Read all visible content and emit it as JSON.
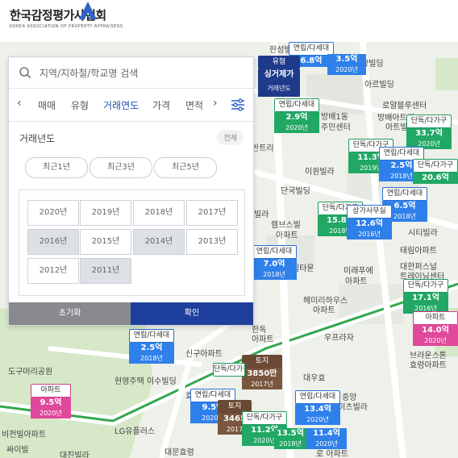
{
  "logo": {
    "ko": "한국감정평가사협회",
    "en": "KOREA ASSOCIATION OF PROPERTY APPRAISERS"
  },
  "search": {
    "placeholder": "지역/지하철/학교명 검색"
  },
  "tabs": [
    "매매",
    "유형",
    "거래연도",
    "가격",
    "면적"
  ],
  "active_tab": "거래연도",
  "section": {
    "title": "거래년도",
    "all_label": "전체"
  },
  "quick": [
    "최근1년",
    "최근3년",
    "최근5년"
  ],
  "years": [
    "2020년",
    "2019년",
    "2018년",
    "2017년",
    "2016년",
    "2015년",
    "2014년",
    "2013년",
    "2012년",
    "2011년"
  ],
  "selected_years": [
    "2016년",
    "2014년",
    "2011년"
  ],
  "buttons": {
    "reset": "초기화",
    "confirm": "확인"
  },
  "colors": {
    "accent": "#1e3f9b",
    "active_tab": "#1f4fb5"
  },
  "map_labels": [
    "한성빌",
    "광빌딩",
    "아르빌딩",
    "로얄블루센터",
    "방배1동",
    "주민센터",
    "방배아트빌",
    "아트빌라",
    "반트리",
    "이원빌라",
    "단국빌딩",
    "빌라",
    "렘브스빌",
    "아파트",
    "림타운",
    "시티빌라",
    "태림아파트",
    "미래푸에",
    "아파트",
    "대한퍼스널",
    "트레이닝센터",
    "헤미리하우스",
    "아파트",
    "한독",
    "아파트",
    "우프라자",
    "신구아파트",
    "브라운스톤",
    "효령아파트",
    "도구머리공원",
    "현영주택 이수빌딩",
    "효령빌",
    "대우효",
    "중앙",
    "하이츠빌라",
    "LG유플러스",
    "비전빌아파트",
    "싸이빌",
    "대진빌라",
    "대문효령",
    "로 아파트"
  ],
  "markers": [
    {
      "type": "연립/다세대",
      "price": "6.8억",
      "year": "",
      "color": "blue"
    },
    {
      "type": "",
      "price": "3.5억",
      "year": "2020년",
      "color": "blue"
    },
    {
      "type": "유형",
      "price": "싱거제가",
      "year": "거래년도",
      "color": "navy"
    },
    {
      "type": "연립/다세대",
      "price": "2.9억",
      "year": "2020년",
      "color": "green"
    },
    {
      "type": "단독/다가구",
      "price": "33.7억",
      "year": "2020년",
      "color": "green"
    },
    {
      "type": "단독/다가구",
      "price": "11.3억",
      "year": "2019년",
      "color": "green"
    },
    {
      "type": "연립/다세대",
      "price": "2.5억",
      "year": "2018년",
      "color": "blue"
    },
    {
      "type": "단독/다가구",
      "price": "20.6억",
      "year": "",
      "color": "green"
    },
    {
      "type": "연립/다세대",
      "price": "6.5억",
      "year": "2018년",
      "color": "blue"
    },
    {
      "type": "단독/다가구",
      "price": "15.8억",
      "year": "2018년",
      "color": "green"
    },
    {
      "type": "상가사무실",
      "price": "12.6억",
      "year": "2016년",
      "color": "blue"
    },
    {
      "type": "연립/다세대",
      "price": "7.0억",
      "year": "2018년",
      "color": "blue"
    },
    {
      "type": "단독/다가구",
      "price": "17.1억",
      "year": "2016년",
      "color": "green"
    },
    {
      "type": "아파트",
      "price": "14.0억",
      "year": "2020년",
      "color": "pink"
    },
    {
      "type": "연립/다세대",
      "price": "2.5억",
      "year": "2018년",
      "color": "blue"
    },
    {
      "type": "토지",
      "price": "3850만",
      "year": "2017년",
      "color": "brown"
    },
    {
      "type": "아파트",
      "price": "9.5억",
      "year": "2020년",
      "color": "pink"
    },
    {
      "type": "연립/다세대",
      "price": "9.5억",
      "year": "2020년",
      "color": "blue"
    },
    {
      "type": "토지",
      "price": "3465",
      "year": "2017",
      "color": "brown"
    },
    {
      "type": "단독/다가구",
      "price": "11.2억",
      "year": "2020년",
      "color": "green"
    },
    {
      "type": "연립/다세대",
      "price": "13.4억",
      "year": "2020년",
      "color": "blue"
    },
    {
      "type": "",
      "price": "11.4억",
      "year": "2020년",
      "color": "blue"
    },
    {
      "type": "",
      "price": "13.5억",
      "year": "2018년",
      "color": "green"
    },
    {
      "type": "단독/다가구",
      "price": "",
      "year": "",
      "color": "green"
    }
  ]
}
